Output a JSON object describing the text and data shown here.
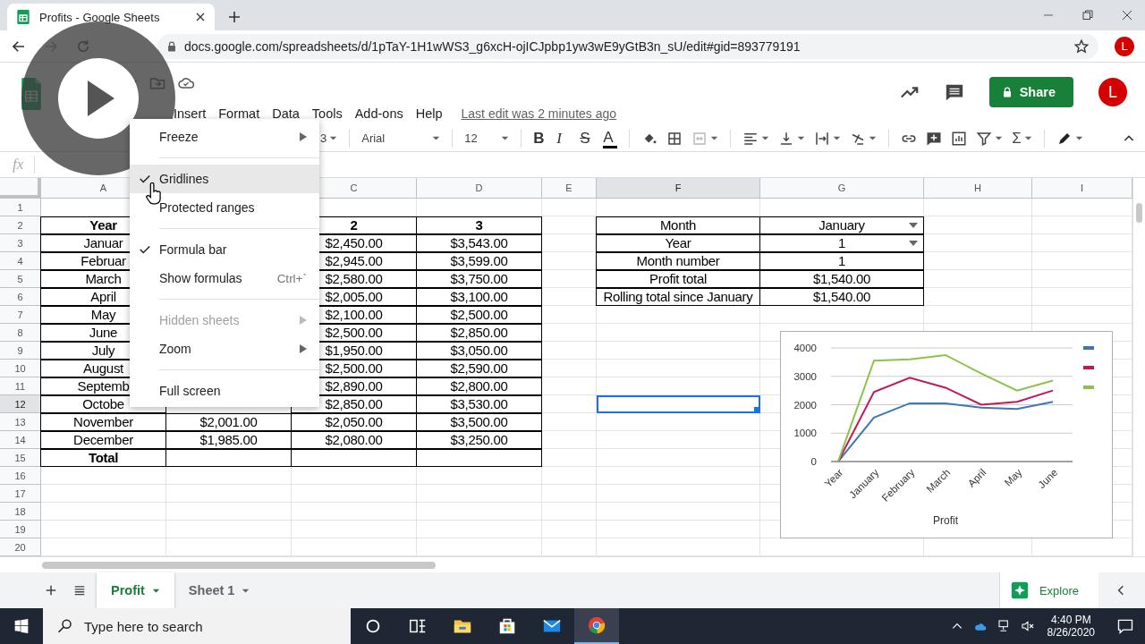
{
  "browser": {
    "tab_title": "Profits - Google Sheets",
    "url": "docs.google.com/spreadsheets/d/1pTaY-1H1wWS3_g6xcH-ojICJpbp1yw3wE9yGtB3n_sU/edit#gid=893779191",
    "avatar": "L"
  },
  "app": {
    "menus": [
      "Insert",
      "Format",
      "Data",
      "Tools",
      "Add-ons",
      "Help"
    ],
    "last_edit": "Last edit was 2 minutes ago",
    "share": "Share",
    "avatar": "L"
  },
  "toolbar": {
    "format_fragment": "3",
    "font": "Arial",
    "font_size": "12",
    "text_styles": [
      {
        "kind": "bold",
        "glyph": "B"
      },
      {
        "kind": "italic",
        "glyph": "I"
      },
      {
        "kind": "strike",
        "glyph": "S"
      },
      {
        "kind": "color",
        "glyph": "A"
      }
    ],
    "functions_glyph": "Σ"
  },
  "formula_bar": {
    "label": "fx"
  },
  "sheet": {
    "columns": [
      {
        "label": "A"
      },
      {},
      {
        "label": "C"
      },
      {
        "label": "D"
      },
      {
        "label": "E"
      },
      {
        "label": "F"
      },
      {
        "label": "G"
      },
      {
        "label": "H"
      },
      {
        "label": "I"
      }
    ],
    "rows": [
      {
        "number": "1"
      },
      {
        "number": "2",
        "cells": [
          {
            "text": "Year",
            "bold": true,
            "boxed": true
          },
          null,
          {
            "text": "2",
            "bold": true,
            "boxed": true
          },
          {
            "text": "3",
            "bold": true,
            "boxed": true
          },
          null,
          {
            "text": "Month",
            "boxed": true
          },
          {
            "text": "January",
            "boxed": true,
            "dropdown": true
          },
          null,
          null
        ]
      },
      {
        "number": "3",
        "cells": [
          {
            "text": "Januar",
            "boxed": true
          },
          null,
          {
            "text": "$2,450.00",
            "boxed": true
          },
          {
            "text": "$3,543.00",
            "boxed": true
          },
          null,
          {
            "text": "Year",
            "boxed": true
          },
          {
            "text": "1",
            "boxed": true,
            "dropdown": true
          },
          null,
          null
        ]
      },
      {
        "number": "4",
        "cells": [
          {
            "text": "Februar",
            "boxed": true
          },
          null,
          {
            "text": "$2,945.00",
            "boxed": true
          },
          {
            "text": "$3,599.00",
            "boxed": true
          },
          null,
          {
            "text": "Month number",
            "boxed": true
          },
          {
            "text": "1",
            "boxed": true
          },
          null,
          null
        ]
      },
      {
        "number": "5",
        "cells": [
          {
            "text": "March",
            "boxed": true
          },
          null,
          {
            "text": "$2,580.00",
            "boxed": true
          },
          {
            "text": "$3,750.00",
            "boxed": true
          },
          null,
          {
            "text": "Profit total",
            "boxed": true
          },
          {
            "text": "$1,540.00",
            "boxed": true
          },
          null,
          null
        ]
      },
      {
        "number": "6",
        "cells": [
          {
            "text": "April",
            "boxed": true
          },
          null,
          {
            "text": "$2,005.00",
            "boxed": true
          },
          {
            "text": "$3,100.00",
            "boxed": true
          },
          null,
          {
            "text": "Rolling total since January",
            "boxed": true
          },
          {
            "text": "$1,540.00",
            "boxed": true
          },
          null,
          null
        ]
      },
      {
        "number": "7",
        "cells": [
          {
            "text": "May",
            "boxed": true
          },
          null,
          {
            "text": "$2,100.00",
            "boxed": true
          },
          {
            "text": "$2,500.00",
            "boxed": true
          },
          null,
          null,
          null,
          null,
          null
        ]
      },
      {
        "number": "8",
        "cells": [
          {
            "text": "June",
            "boxed": true
          },
          null,
          {
            "text": "$2,500.00",
            "boxed": true
          },
          {
            "text": "$2,850.00",
            "boxed": true
          },
          null,
          null,
          null,
          null,
          null
        ]
      },
      {
        "number": "9",
        "cells": [
          {
            "text": "July",
            "boxed": true
          },
          null,
          {
            "text": "$1,950.00",
            "boxed": true
          },
          {
            "text": "$3,050.00",
            "boxed": true
          },
          null,
          null,
          null,
          null,
          null
        ]
      },
      {
        "number": "10",
        "cells": [
          {
            "text": "August",
            "boxed": true
          },
          null,
          {
            "text": "$2,500.00",
            "boxed": true
          },
          {
            "text": "$2,590.00",
            "boxed": true
          },
          null,
          null,
          null,
          null,
          null
        ]
      },
      {
        "number": "11",
        "cells": [
          {
            "text": "Septemb",
            "boxed": true
          },
          null,
          {
            "text": "$2,890.00",
            "boxed": true
          },
          {
            "text": "$2,800.00",
            "boxed": true
          },
          null,
          null,
          null,
          null,
          null
        ]
      },
      {
        "number": "12",
        "cells": [
          {
            "text": "Octobe",
            "boxed": true
          },
          null,
          {
            "text": "$2,850.00",
            "boxed": true
          },
          {
            "text": "$3,530.00",
            "boxed": true
          },
          null,
          {
            "selected": true
          },
          null,
          null,
          null
        ]
      },
      {
        "number": "13",
        "cells": [
          {
            "text": "November",
            "boxed": true
          },
          {
            "text": "$2,001.00",
            "boxed": true
          },
          {
            "text": "$2,050.00",
            "boxed": true
          },
          {
            "text": "$3,500.00",
            "boxed": true
          },
          null,
          null,
          null,
          null,
          null
        ]
      },
      {
        "number": "14",
        "cells": [
          {
            "text": "December",
            "boxed": true
          },
          {
            "text": "$1,985.00",
            "boxed": true
          },
          {
            "text": "$2,080.00",
            "boxed": true
          },
          {
            "text": "$3,250.00",
            "boxed": true
          },
          null,
          null,
          null,
          null,
          null
        ]
      },
      {
        "number": "15",
        "cells": [
          {
            "text": "Total",
            "bold": true,
            "boxed": true
          },
          {
            "boxed": true
          },
          {
            "boxed": true
          },
          {
            "boxed": true
          },
          null,
          null,
          null,
          null,
          null
        ]
      },
      {
        "number": "16"
      },
      {
        "number": "17"
      },
      {
        "number": "18"
      },
      {
        "number": "19"
      },
      {
        "number": "20"
      }
    ]
  },
  "chart": {
    "chart_data": {
      "type": "line",
      "xlabel": "Profit",
      "categories": [
        "Year",
        "January",
        "February",
        "March",
        "April",
        "May",
        "June"
      ],
      "yticks": [
        0,
        1000,
        2000,
        3000,
        4000
      ],
      "ylim": [
        0,
        4000
      ],
      "grid": true,
      "series": [
        {
          "color": "#3d78b4",
          "values": [
            0,
            1550,
            2050,
            2050,
            1900,
            1850,
            2100
          ]
        },
        {
          "color": "#c2185b",
          "values": [
            0,
            2450,
            2950,
            2600,
            2000,
            2100,
            2500
          ]
        },
        {
          "color": "#8bc34a",
          "values": [
            0,
            3550,
            3600,
            3750,
            3100,
            2500,
            2850
          ]
        }
      ]
    }
  },
  "view_menu": {
    "items": [
      {
        "kind": "item",
        "label": "Freeze",
        "submenu": true,
        "checked": false,
        "disabled": false,
        "highlighted": false
      },
      {
        "kind": "separator"
      },
      {
        "kind": "item",
        "label": "Gridlines",
        "submenu": false,
        "checked": true,
        "disabled": false,
        "highlighted": true
      },
      {
        "kind": "item",
        "label": "Protected ranges",
        "submenu": false,
        "checked": false,
        "disabled": false,
        "highlighted": false
      },
      {
        "kind": "separator"
      },
      {
        "kind": "item",
        "label": "Formula bar",
        "submenu": false,
        "checked": true,
        "disabled": false,
        "highlighted": false
      },
      {
        "kind": "item",
        "label": "Show formulas",
        "shortcut": "Ctrl+`",
        "submenu": false,
        "checked": false,
        "disabled": false,
        "highlighted": false
      },
      {
        "kind": "separator"
      },
      {
        "kind": "item",
        "label": "Hidden sheets",
        "submenu": true,
        "checked": false,
        "disabled": true,
        "highlighted": false
      },
      {
        "kind": "item",
        "label": "Zoom",
        "submenu": true,
        "checked": false,
        "disabled": false,
        "highlighted": false
      },
      {
        "kind": "separator"
      },
      {
        "kind": "item",
        "label": "Full screen",
        "submenu": false,
        "checked": false,
        "disabled": false,
        "highlighted": false
      }
    ]
  },
  "sheet_tabs": [
    {
      "label": "Profit",
      "selected": true
    },
    {
      "label": "Sheet 1",
      "selected": false
    }
  ],
  "explore": "Explore",
  "taskbar": {
    "search_placeholder": "Type here to search",
    "time": "4:40 PM",
    "date": "8/26/2020"
  }
}
